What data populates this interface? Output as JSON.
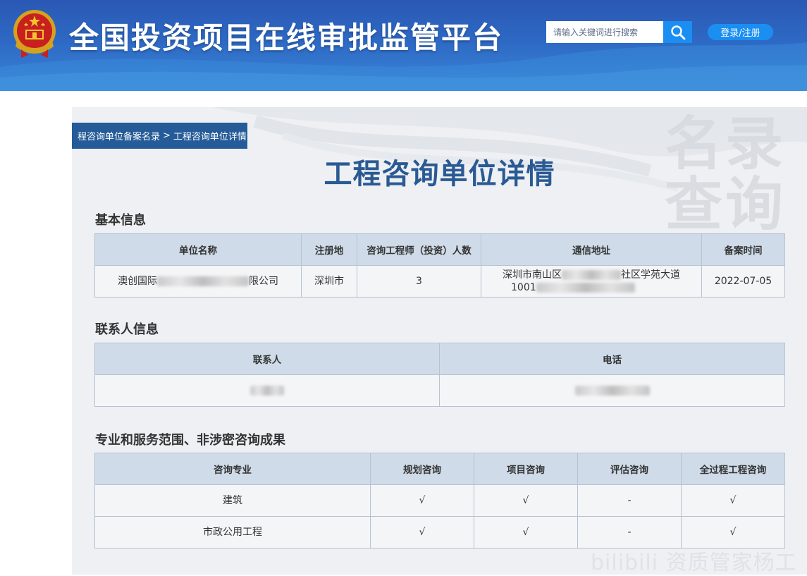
{
  "header": {
    "site_title": "全国投资项目在线审批监管平台",
    "search_placeholder": "请输入关键词进行搜索",
    "login_label": "登录/注册"
  },
  "breadcrumb": {
    "parent": "程咨询单位备案名录",
    "separator": ">",
    "current": "工程咨询单位详情"
  },
  "watermark": {
    "line1": "名录",
    "line2": "查询"
  },
  "page_title": "工程咨询单位详情",
  "basic_info": {
    "section_title": "基本信息",
    "headers": [
      "单位名称",
      "注册地",
      "咨询工程师（投资）人数",
      "通信地址",
      "备案时间"
    ],
    "row": {
      "name_prefix": "澳创国际",
      "name_suffix": "限公司",
      "region": "深圳市",
      "engineer_count": "3",
      "address_line1_prefix": "深圳市南山区",
      "address_line1_suffix": "社区学苑大道",
      "address_line2_prefix": "1001",
      "filing_date": "2022-07-05"
    }
  },
  "contact_info": {
    "section_title": "联系人信息",
    "headers": [
      "联系人",
      "电话"
    ]
  },
  "scope": {
    "section_title": "专业和服务范围、非涉密咨询成果",
    "headers": [
      "咨询专业",
      "规划咨询",
      "项目咨询",
      "评估咨询",
      "全过程工程咨询"
    ],
    "rows": [
      {
        "major": "建筑",
        "planning": "√",
        "project": "√",
        "assessment": "-",
        "whole_process": "√"
      },
      {
        "major": "市政公用工程",
        "planning": "√",
        "project": "√",
        "assessment": "-",
        "whole_process": "√"
      }
    ]
  },
  "footer_watermark": "bilibili 资质管家杨工",
  "colors": {
    "header_blue": "#2d69c4",
    "button_blue": "#1b8ef2",
    "title_blue": "#2a5a94",
    "table_header": "#cfdbe8"
  }
}
